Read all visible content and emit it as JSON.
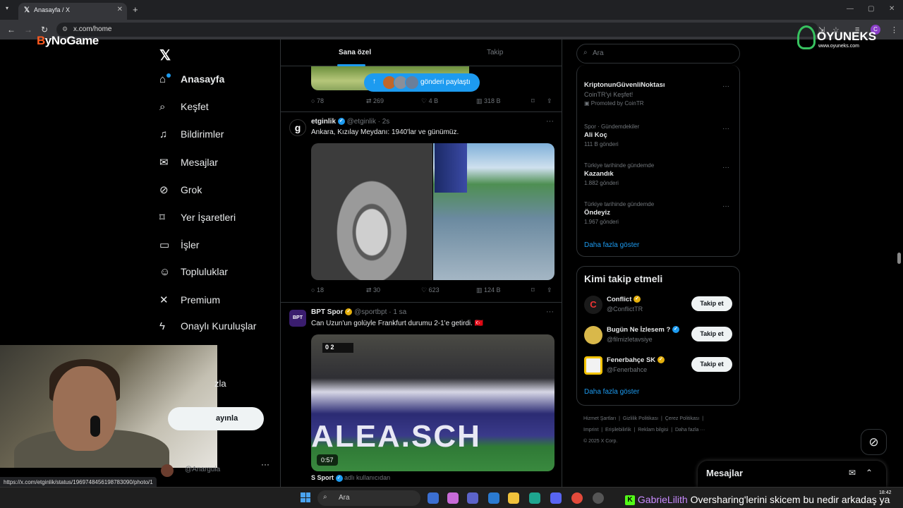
{
  "browser": {
    "tab_title": "Anasayfa / X",
    "url": "x.com/home",
    "status_url": "https://x.com/etginlik/status/1969748456198783090/photo/1"
  },
  "overlays": {
    "brand_left_b": "B",
    "brand_left_rest": "yNoGame",
    "brand_right": "OYUNEKS",
    "brand_right_sub": "www.oyuneks.com"
  },
  "sidebar": {
    "items": [
      {
        "label": "Anasayfa",
        "icon": "home-icon",
        "glyph": "⌂"
      },
      {
        "label": "Keşfet",
        "icon": "search-icon",
        "glyph": "⌕"
      },
      {
        "label": "Bildirimler",
        "icon": "bell-icon",
        "glyph": "♫"
      },
      {
        "label": "Mesajlar",
        "icon": "mail-icon",
        "glyph": "✉"
      },
      {
        "label": "Grok",
        "icon": "grok-icon",
        "glyph": "⊘"
      },
      {
        "label": "Yer İşaretleri",
        "icon": "bookmark-icon",
        "glyph": "⌑"
      },
      {
        "label": "İşler",
        "icon": "briefcase-icon",
        "glyph": "▭"
      },
      {
        "label": "Topluluklar",
        "icon": "people-icon",
        "glyph": "☺"
      },
      {
        "label": "Premium",
        "icon": "x-icon",
        "glyph": "✕"
      },
      {
        "label": "Onaylı Kuruluşlar",
        "icon": "lightning-icon",
        "glyph": "ϟ"
      }
    ],
    "partial_item": "zla",
    "post_button": "ayınla",
    "account_handle": "@Anarguia",
    "more": "···"
  },
  "timeline": {
    "tabs": [
      "Sana özel",
      "Takip"
    ],
    "share_pill": "gönderi paylaştı",
    "tweet0_actions": {
      "replies": "78",
      "retweets": "269",
      "likes": "4 B",
      "views": "318 B"
    },
    "tweets": [
      {
        "name": "etginlik",
        "handle": "@etginlik",
        "time": "2s",
        "text": "Ankara, Kızılay Meydanı: 1940'lar ve günümüz.",
        "actions": {
          "replies": "18",
          "retweets": "30",
          "likes": "623",
          "views": "124 B"
        }
      },
      {
        "name": "BPT Spor",
        "handle": "@sportbpt",
        "time": "1 sa",
        "text": "Can Uzun'un golüyle Frankfurt durumu 2-1'e getirdi. 🇹🇷",
        "video_banner": "ALEA.SCH",
        "video_score": "0 2",
        "duration": "0:57"
      }
    ],
    "next_author": "S Sport",
    "next_author_meta": "adlı kullanıcıdan"
  },
  "right": {
    "search_placeholder": "Ara",
    "trends": [
      {
        "category": "CoinTR'yi Keşfet!",
        "name": "KriptonunGüvenliNoktası",
        "count": "Promoted by CoinTR",
        "promoted": true
      },
      {
        "category": "Spor · Gündemdekiler",
        "name": "Ali Koç",
        "count": "111 B gönderi"
      },
      {
        "category": "Türkiye tarihinde gündemde",
        "name": "Kazandık",
        "count": "1.882 gönderi"
      },
      {
        "category": "Türkiye tarihinde gündemde",
        "name": "Öndeyiz",
        "count": "1.967 gönderi"
      }
    ],
    "show_more": "Daha fazla göster",
    "who_title": "Kimi takip etmeli",
    "who": [
      {
        "name": "Conflict",
        "handle": "@ConflictTR",
        "follow": "Takip et",
        "avatar_color": "#1a1a1a"
      },
      {
        "name": "Bugün Ne İzlesem ?",
        "handle": "@filmizletavsiye",
        "follow": "Takip et",
        "avatar_color": "#d9b84a"
      },
      {
        "name": "Fenerbahçe SK",
        "handle": "@Fenerbahce",
        "follow": "Takip et",
        "avatar_color": "#f2f2f2"
      }
    ],
    "who_more": "Daha fazla göster",
    "footer": [
      "Hizmet Şartları",
      "Gizlilik Politikası",
      "Çerez Politikası",
      "Imprint",
      "Erişilebilirlik",
      "Reklam bilgisi",
      "Daha fazla ···",
      "© 2025 X Corp."
    ]
  },
  "messages_drawer": {
    "title": "Mesajlar"
  },
  "taskbar": {
    "search": "Ara",
    "chat_user": "GabrieLilith",
    "chat_message": "Oversharing'lerini skicem bu nedir arkadaş ya",
    "time": "18:42"
  },
  "colors": {
    "accent": "#1d9bf0",
    "background": "#000000",
    "border": "#2f3336",
    "kick_green": "#53fc18"
  }
}
